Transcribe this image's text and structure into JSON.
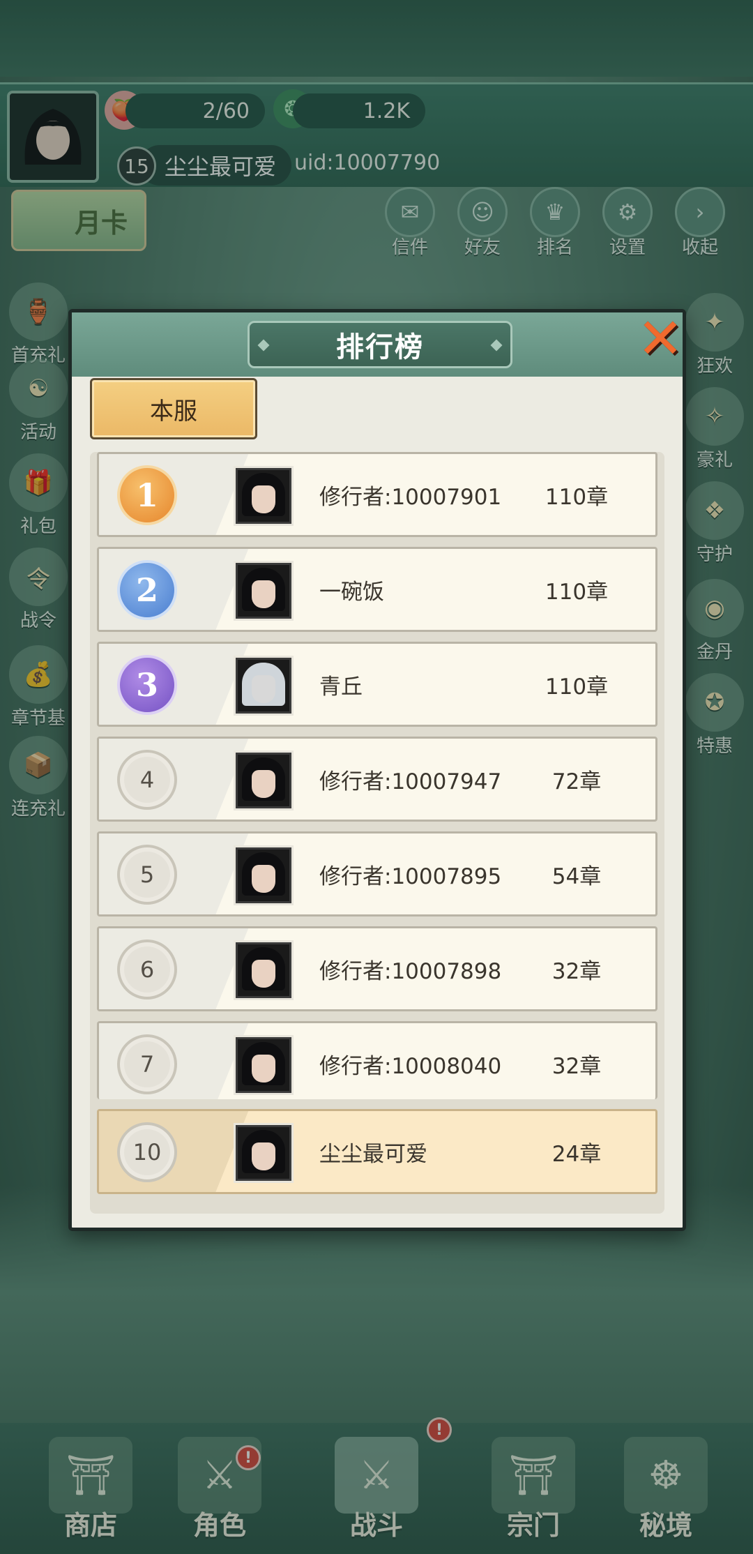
{
  "hud": {
    "stamina": "2/60",
    "currency": "1.2K",
    "level": "15",
    "player_name": "尘尘最可爱",
    "uid": "uid:10007790",
    "month_card": "月卡"
  },
  "top_menu": [
    {
      "label": "信件",
      "icon": "mail-icon"
    },
    {
      "label": "好友",
      "icon": "friends-icon"
    },
    {
      "label": "排名",
      "icon": "ranking-icon"
    },
    {
      "label": "设置",
      "icon": "gear-icon"
    },
    {
      "label": "收起",
      "icon": "chevron-right-icon"
    }
  ],
  "left_menu": [
    "首充礼",
    "活动",
    "礼包",
    "战令",
    "章节基",
    "连充礼"
  ],
  "right_menu": [
    "狂欢",
    "豪礼",
    "守护",
    "金丹",
    "特惠"
  ],
  "bottom_nav": [
    {
      "label": "商店",
      "alert": false
    },
    {
      "label": "角色",
      "alert": true
    },
    {
      "label": "战斗",
      "alert": true
    },
    {
      "label": "宗门",
      "alert": false
    },
    {
      "label": "秘境",
      "alert": false
    }
  ],
  "modal": {
    "title": "排行榜",
    "tab": "本服",
    "rows": [
      {
        "rank": "1",
        "name": "修行者:10007901",
        "chapter": "110章",
        "medal": "gold"
      },
      {
        "rank": "2",
        "name": "一碗饭",
        "chapter": "110章",
        "medal": "silver"
      },
      {
        "rank": "3",
        "name": "青丘",
        "chapter": "110章",
        "medal": "bronze"
      },
      {
        "rank": "4",
        "name": "修行者:10007947",
        "chapter": "72章",
        "medal": "plain"
      },
      {
        "rank": "5",
        "name": "修行者:10007895",
        "chapter": "54章",
        "medal": "plain"
      },
      {
        "rank": "6",
        "name": "修行者:10007898",
        "chapter": "32章",
        "medal": "plain"
      },
      {
        "rank": "7",
        "name": "修行者:10008040",
        "chapter": "32章",
        "medal": "plain"
      }
    ],
    "self_row": {
      "rank": "10",
      "name": "尘尘最可爱",
      "chapter": "24章"
    }
  },
  "colors": {
    "gold_medal": "#e6862c",
    "silver_medal": "#4a7ed0",
    "bronze_medal": "#7552c4",
    "close_x": "#f06a2e"
  }
}
